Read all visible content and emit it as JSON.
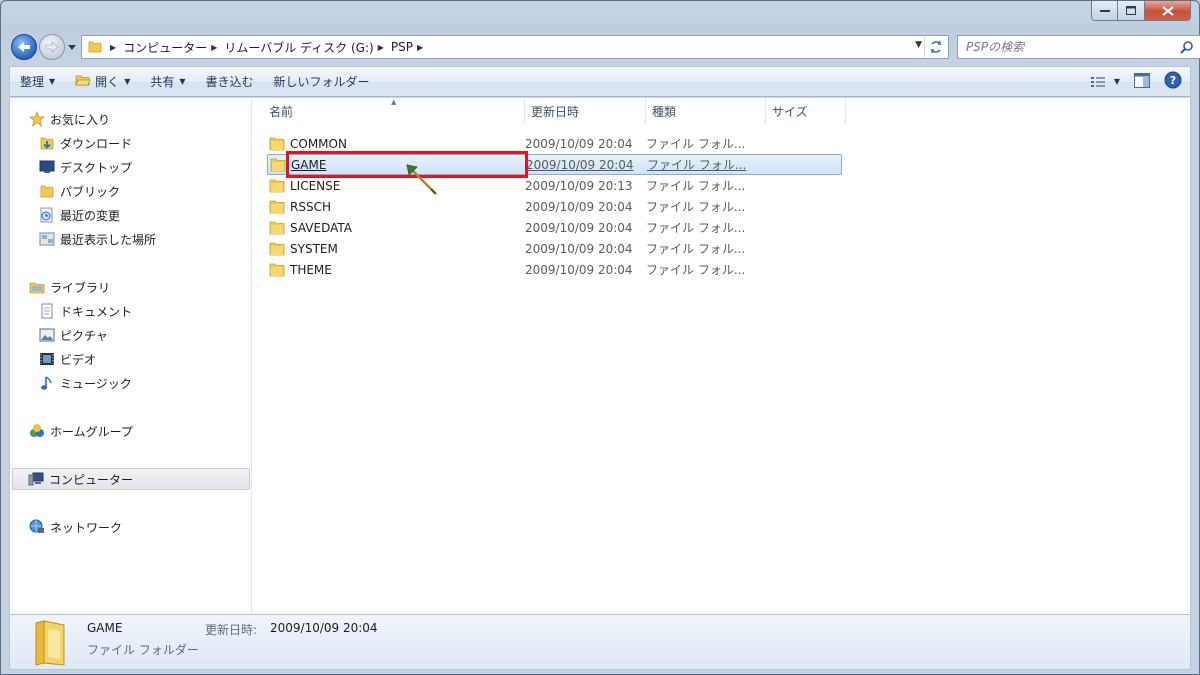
{
  "window": {
    "minimize": "minimize",
    "maximize": "maximize",
    "close": "close"
  },
  "address": {
    "breadcrumbs": [
      "コンピューター",
      "リムーバブル ディスク (G:)",
      "PSP"
    ]
  },
  "search": {
    "placeholder": "PSPの検索"
  },
  "toolbar": {
    "organize": "整理",
    "open": "開く",
    "share": "共有",
    "burn": "書き込む",
    "new_folder": "新しいフォルダー"
  },
  "nav": {
    "favorites": "お気に入り",
    "downloads": "ダウンロード",
    "desktop": "デスクトップ",
    "public": "パブリック",
    "recent_changes": "最近の変更",
    "recent_places": "最近表示した場所",
    "libraries": "ライブラリ",
    "documents": "ドキュメント",
    "pictures": "ピクチャ",
    "videos": "ビデオ",
    "music": "ミュージック",
    "homegroup": "ホームグループ",
    "computer": "コンピューター",
    "network": "ネットワーク"
  },
  "columns": {
    "name": "名前",
    "date": "更新日時",
    "type": "種類",
    "size": "サイズ"
  },
  "files": [
    {
      "name": "COMMON",
      "date": "2009/10/09 20:04",
      "type": "ファイル フォル..."
    },
    {
      "name": "GAME",
      "date": "2009/10/09 20:04",
      "type": "ファイル フォル..."
    },
    {
      "name": "LICENSE",
      "date": "2009/10/09 20:13",
      "type": "ファイル フォル..."
    },
    {
      "name": "RSSCH",
      "date": "2009/10/09 20:04",
      "type": "ファイル フォル..."
    },
    {
      "name": "SAVEDATA",
      "date": "2009/10/09 20:04",
      "type": "ファイル フォル..."
    },
    {
      "name": "SYSTEM",
      "date": "2009/10/09 20:04",
      "type": "ファイル フォル..."
    },
    {
      "name": "THEME",
      "date": "2009/10/09 20:04",
      "type": "ファイル フォル..."
    }
  ],
  "details": {
    "name": "GAME",
    "type": "ファイル フォルダー",
    "date_label": "更新日時:",
    "date": "2009/10/09 20:04"
  },
  "colors": {
    "highlight": "#e0161b",
    "selection": "#cfe3fa",
    "folder": "#f2c94c"
  }
}
